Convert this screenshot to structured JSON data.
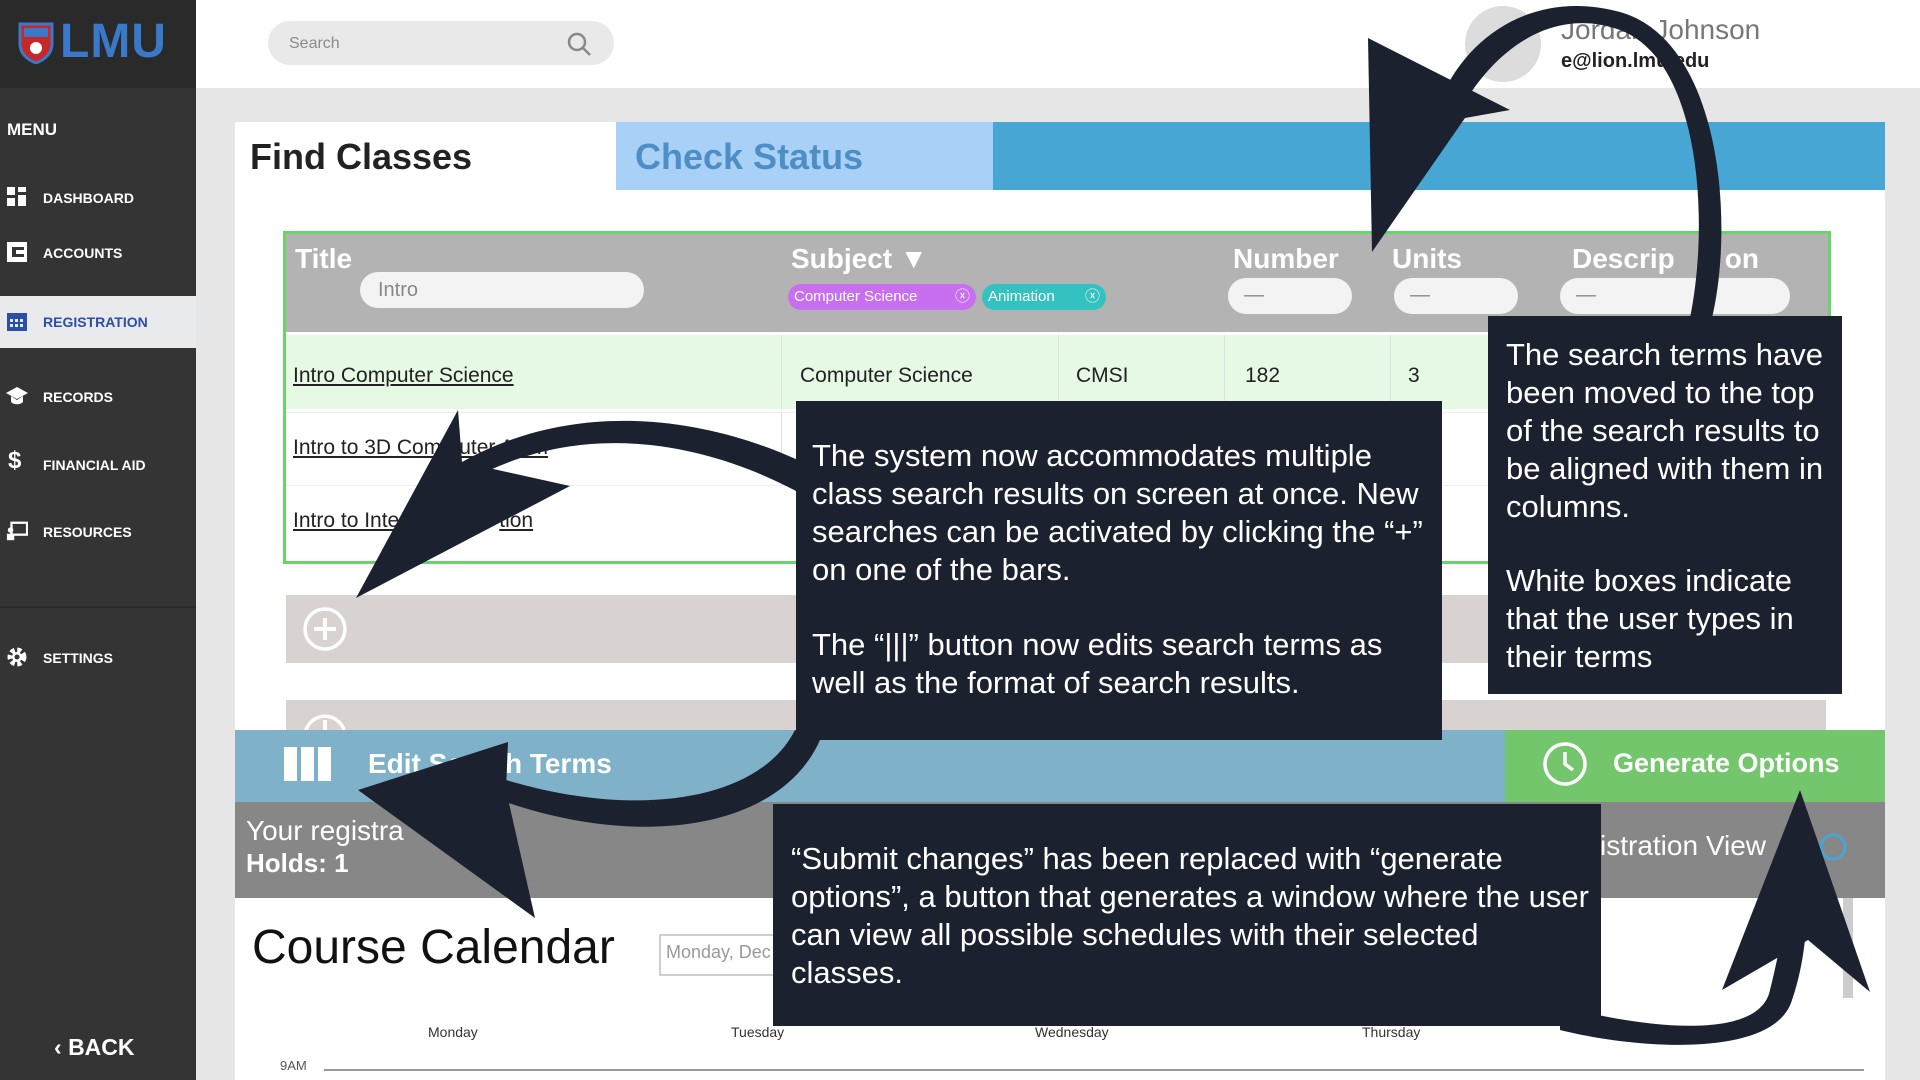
{
  "sidebar": {
    "logo_text": "LMU",
    "menu_heading": "MENU",
    "items": [
      {
        "label": "DASHBOARD",
        "icon": "grid-icon"
      },
      {
        "label": "ACCOUNTS",
        "icon": "card-icon"
      },
      {
        "label": "REGISTRATION",
        "icon": "calendar-icon",
        "active": true
      },
      {
        "label": "RECORDS",
        "icon": "graduation-cap-icon"
      },
      {
        "label": "FINANCIAL AID",
        "icon": "dollar-icon"
      },
      {
        "label": "RESOURCES",
        "icon": "presentation-icon"
      },
      {
        "label": "SETTINGS",
        "icon": "gear-icon"
      }
    ],
    "back_label": "BACK"
  },
  "header": {
    "search_placeholder": "Search",
    "user_name": "Jordan Johnson",
    "user_email": "e@lion.lmu.edu"
  },
  "tabs": {
    "find": "Find Classes",
    "check": "Check Status"
  },
  "search_terms": {
    "title_label": "Title",
    "title_value": "Intro",
    "subject_label": "Subject",
    "subject_chips": [
      "Computer Science",
      "Animation"
    ],
    "number_label": "Number",
    "units_label": "Units",
    "description_label": "Descrip",
    "description_label_tail": "on",
    "empty_value": "—"
  },
  "results": [
    {
      "title": "Intro Computer Science",
      "subject": "Computer Science",
      "code": "CMSI",
      "number": "182",
      "units": "3"
    },
    {
      "title": "Intro to 3D Com",
      "title_tail": "uter Anim"
    },
    {
      "title": "Intro to Inte",
      "title_tail": "tion"
    }
  ],
  "bottom": {
    "edit_label": "Edit Search Terms",
    "generate_label": "Generate Options",
    "status_line1": "Your registra",
    "status_line2": "Holds: 1",
    "reg_view_label": "istration View"
  },
  "calendar": {
    "title": "Course Calendar",
    "date_text": "Monday, Dec",
    "days": [
      "Monday",
      "Tuesday",
      "Wednesday",
      "Thursday"
    ],
    "first_time": "9AM"
  },
  "callouts": {
    "right_p1": "The search terms have been moved to the top of the search results to be aligned with them in columns.",
    "right_p2": "White boxes indicate that the user types in their terms",
    "center_p1": "The system now accommodates multiple class search results on screen at once. New searches can be activated by clicking the “+” on one of the bars.",
    "center_p2": "The “|||” button now edits search terms as well as the format of search results.",
    "bottom_p1": "“Submit changes” has been replaced with “generate options”, a button that generates a window where the user can view all possible schedules with their selected classes."
  },
  "colors": {
    "sidebar_bg": "#343434",
    "accent_blue": "#47a6d4",
    "check_tab": "#a9d0f6",
    "table_border_green": "#6cd36c",
    "generate_green": "#74c66c",
    "edit_blue": "#7fb1c9",
    "chip_purple": "#c86ff0",
    "chip_teal": "#33c2c0",
    "callout_bg": "#1c2130"
  }
}
